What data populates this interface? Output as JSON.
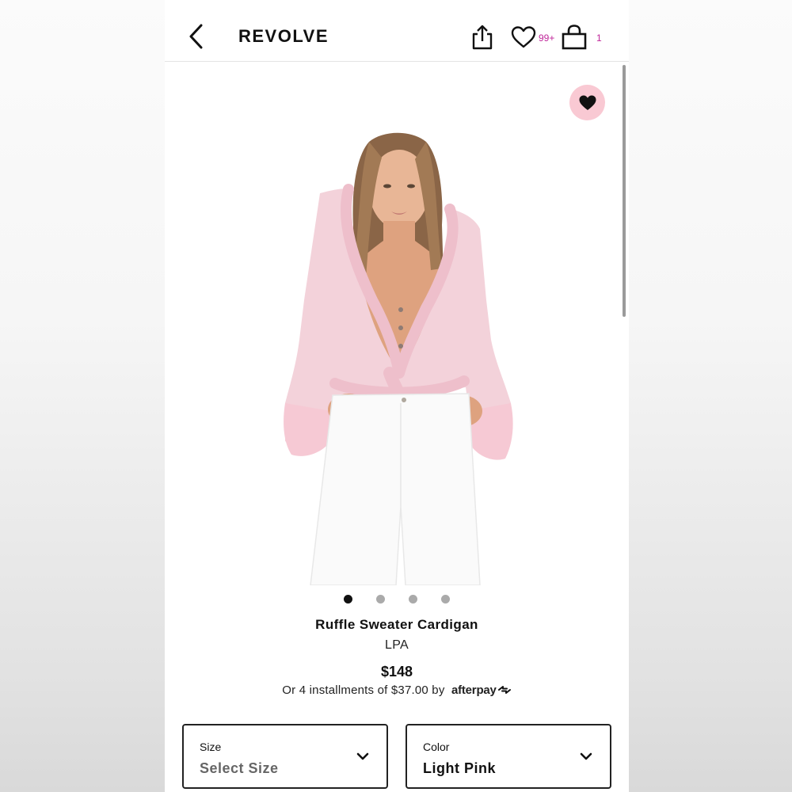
{
  "header": {
    "logo": "REVOLVE",
    "wishlist_count": "99+",
    "bag_count": "1"
  },
  "product": {
    "name": "Ruffle Sweater Cardigan",
    "brand": "LPA",
    "price": "$148",
    "installments_text": "Or 4 installments of $37.00 by",
    "afterpay_label": "afterpay",
    "image_count": 4,
    "active_image_index": 0
  },
  "selectors": {
    "size": {
      "label": "Size",
      "value": "Select Size"
    },
    "color": {
      "label": "Color",
      "value": "Light Pink"
    }
  },
  "colors": {
    "accent_count": "#c0279a",
    "favorite_bg": "#f9c9d3",
    "cardigan": "#f3d2da",
    "pants": "#fafafa"
  },
  "icons": [
    "back-arrow-icon",
    "share-icon",
    "heart-outline-icon",
    "shopping-bag-icon",
    "heart-filled-icon",
    "chevron-down-icon",
    "afterpay-logo-icon"
  ]
}
